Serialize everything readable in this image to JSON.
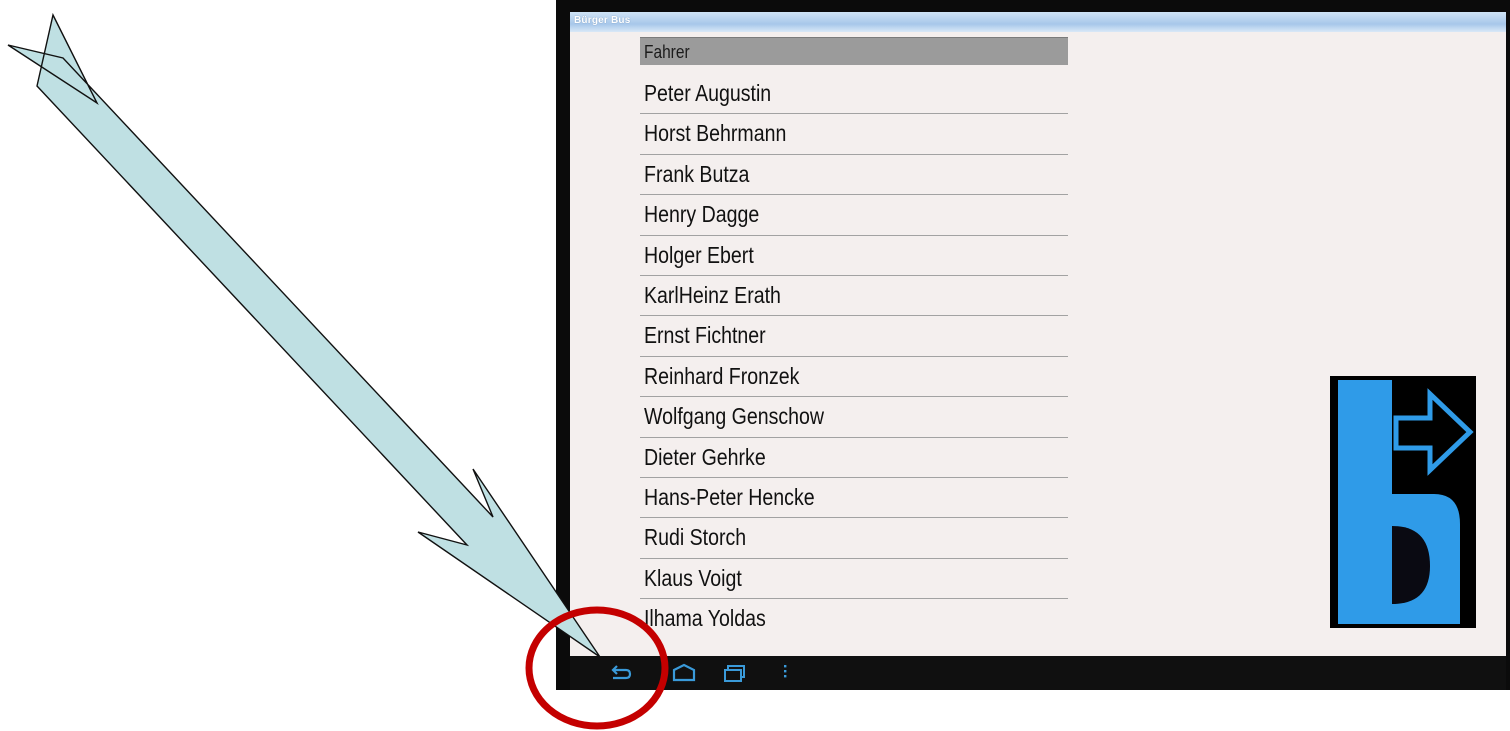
{
  "window": {
    "title": "Bürger Bus"
  },
  "list": {
    "header": "Fahrer",
    "items": [
      "Peter Augustin",
      "Horst Behrmann",
      "Frank Butza",
      "Henry Dagge",
      "Holger Ebert",
      "KarlHeinz Erath",
      "Ernst Fichtner",
      "Reinhard Fronzek",
      "Wolfgang Genschow",
      "Dieter Gehrke",
      "Hans-Peter Hencke",
      "Rudi Storch",
      "Klaus Voigt",
      "Ilhama Yoldas"
    ]
  },
  "navbar": {
    "icons": [
      "back-icon",
      "home-icon",
      "recent-apps-icon",
      "menu-icon"
    ]
  },
  "colors": {
    "screen_bg": "#f4efee",
    "header_bg": "#9b9b9b",
    "logo_blue": "#2f9be8",
    "arrow_fill": "#bfe0e3",
    "highlight_circle": "#c40000",
    "nav_icon": "#3a9ad9"
  }
}
